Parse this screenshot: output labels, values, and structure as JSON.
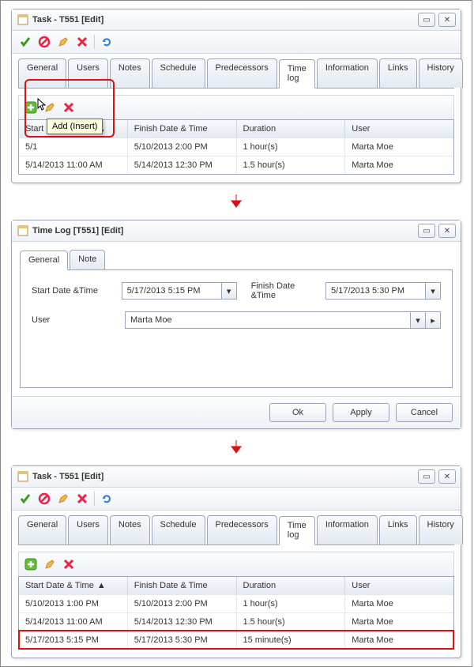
{
  "win1": {
    "title": "Task - T551 [Edit]",
    "tabs": [
      "General",
      "Users",
      "Notes",
      "Schedule",
      "Predecessors",
      "Time log",
      "Information",
      "Links",
      "History"
    ],
    "tooltip": "Add (Insert)",
    "columns": [
      "Start Date & Time",
      "Finish Date & Time",
      "Duration",
      "User"
    ],
    "rows": [
      {
        "start": "5/1",
        "finish": "5/10/2013 2:00 PM",
        "duration": "1 hour(s)",
        "user": "Marta Moe"
      },
      {
        "start": "5/14/2013 11:00 AM",
        "finish": "5/14/2013 12:30 PM",
        "duration": "1.5 hour(s)",
        "user": "Marta Moe"
      }
    ]
  },
  "dlg": {
    "title": "Time Log [T551]  [Edit]",
    "tabs": [
      "General",
      "Note"
    ],
    "start_label": "Start Date &Time",
    "start_val": "5/17/2013 5:15 PM",
    "finish_label": "Finish Date &Time",
    "finish_val": "5/17/2013 5:30 PM",
    "user_label": "User",
    "user_val": "Marta Moe",
    "ok": "Ok",
    "apply": "Apply",
    "cancel": "Cancel"
  },
  "win2": {
    "title": "Task - T551 [Edit]",
    "tabs": [
      "General",
      "Users",
      "Notes",
      "Schedule",
      "Predecessors",
      "Time log",
      "Information",
      "Links",
      "History"
    ],
    "columns": [
      "Start Date & Time",
      "Finish Date & Time",
      "Duration",
      "User"
    ],
    "rows": [
      {
        "start": "5/10/2013 1:00 PM",
        "finish": "5/10/2013 2:00 PM",
        "duration": "1 hour(s)",
        "user": "Marta Moe"
      },
      {
        "start": "5/14/2013 11:00 AM",
        "finish": "5/14/2013 12:30 PM",
        "duration": "1.5 hour(s)",
        "user": "Marta Moe"
      },
      {
        "start": "5/17/2013 5:15 PM",
        "finish": "5/17/2013 5:30 PM",
        "duration": "15 minute(s)",
        "user": "Marta Moe"
      }
    ]
  }
}
